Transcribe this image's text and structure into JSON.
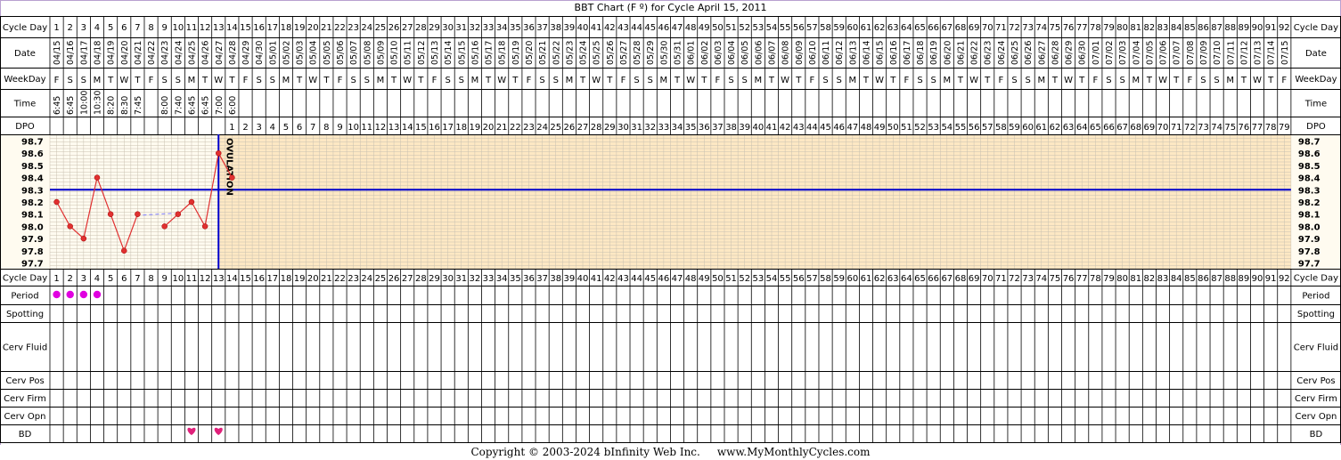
{
  "title": "BBT Chart (F º) for Cycle April 15, 2011",
  "copyright": "Copyright © 2003-2024 bInfinity Web Inc.     www.MyMonthlyCycles.com",
  "row_labels": [
    "Cycle Day",
    "Date",
    "WeekDay",
    "Time",
    "DPO",
    "Cycle Day",
    "Period",
    "Spotting",
    "Cerv Fluid",
    "Cerv Pos",
    "Cerv Firm",
    "Cerv Opn",
    "BD"
  ],
  "ovulation_label": "OVULATION",
  "colors": {
    "grid": "#000000",
    "panel_bg": "#fffbf0",
    "pre_ovulation_bg": "#fffbf0",
    "post_ovulation_bg": "#fde8c4",
    "cover_line": "#0000cc",
    "temp_line": "#e03030",
    "temp_dot": "#e03030",
    "period_dot": "#e000e0",
    "heart": "#e0207a",
    "dashed_line": "#8080ff",
    "border": "#b8a0d0"
  },
  "chart_data": {
    "type": "line",
    "title": "BBT Chart (F º) for Cycle April 15, 2011",
    "cycle_days": [
      1,
      2,
      3,
      4,
      5,
      6,
      7,
      8,
      9,
      10,
      11,
      12,
      13,
      14,
      15,
      16,
      17,
      18,
      19,
      20,
      21,
      22,
      23,
      24,
      25,
      26,
      27,
      28,
      29,
      30,
      31,
      32,
      33,
      34,
      35,
      36,
      37,
      38,
      39,
      40,
      41,
      42,
      43,
      44,
      45,
      46,
      47,
      48,
      49,
      50,
      51,
      52,
      53,
      54,
      55,
      56,
      57,
      58,
      59,
      60,
      61,
      62,
      63,
      64,
      65,
      66,
      67,
      68,
      69,
      70,
      71,
      72,
      73,
      74,
      75,
      76,
      77,
      78,
      79,
      80,
      81,
      82,
      83,
      84,
      85,
      86,
      87,
      88,
      89,
      90,
      91,
      92
    ],
    "dates": [
      "04/15",
      "04/16",
      "04/17",
      "04/18",
      "04/19",
      "04/20",
      "04/21",
      "04/22",
      "04/23",
      "04/24",
      "04/25",
      "04/26",
      "04/27",
      "04/28",
      "04/29",
      "04/30",
      "05/01",
      "05/02",
      "05/03",
      "05/04",
      "05/05",
      "05/06",
      "05/07",
      "05/08",
      "05/09",
      "05/10",
      "05/11",
      "05/12",
      "05/13",
      "05/14",
      "05/15",
      "05/16",
      "05/17",
      "05/18",
      "05/19",
      "05/20",
      "05/21",
      "05/22",
      "05/23",
      "05/24",
      "05/25",
      "05/26",
      "05/27",
      "05/28",
      "05/29",
      "05/30",
      "05/31",
      "06/01",
      "06/02",
      "06/03",
      "06/04",
      "06/05",
      "06/06",
      "06/07",
      "06/08",
      "06/09",
      "06/10",
      "06/11",
      "06/12",
      "06/13",
      "06/14",
      "06/15",
      "06/16",
      "06/17",
      "06/18",
      "06/19",
      "06/20",
      "06/21",
      "06/22",
      "06/23",
      "06/24",
      "06/25",
      "06/26",
      "06/27",
      "06/28",
      "06/29",
      "06/30",
      "07/01",
      "07/02",
      "07/03",
      "07/04",
      "07/05",
      "07/06",
      "07/07",
      "07/08",
      "07/09",
      "07/10",
      "07/11",
      "07/12",
      "07/13",
      "07/14",
      "07/15"
    ],
    "weekdays": [
      "F",
      "S",
      "S",
      "M",
      "T",
      "W",
      "T",
      "F",
      "S",
      "S",
      "M",
      "T",
      "W",
      "T",
      "F",
      "S",
      "S",
      "M",
      "T",
      "W",
      "T",
      "F",
      "S",
      "S",
      "M",
      "T",
      "W",
      "T",
      "F",
      "S",
      "S",
      "M",
      "T",
      "W",
      "T",
      "F",
      "S",
      "S",
      "M",
      "T",
      "W",
      "T",
      "F",
      "S",
      "S",
      "M",
      "T",
      "W",
      "T",
      "F",
      "S",
      "S",
      "M",
      "T",
      "W",
      "T",
      "F",
      "S",
      "S",
      "M",
      "T",
      "W",
      "T",
      "F",
      "S",
      "S",
      "M",
      "T",
      "W",
      "T",
      "F",
      "S",
      "S",
      "M",
      "T",
      "W",
      "T",
      "F",
      "S",
      "S",
      "M",
      "T",
      "W",
      "T",
      "F",
      "S",
      "S",
      "M",
      "T",
      "W",
      "T",
      "F"
    ],
    "times": [
      "6:45",
      "6:45",
      "10:00",
      "10:30",
      "8:20",
      "8:30",
      "7:45",
      "",
      "8:00",
      "7:40",
      "6:45",
      "6:45",
      "7:00",
      "6:00"
    ],
    "dpo_start_day": 14,
    "dpo_count": 79,
    "temperatures": [
      98.2,
      98.0,
      97.9,
      98.4,
      98.1,
      97.8,
      98.1,
      null,
      98.0,
      98.1,
      98.2,
      98.0,
      98.6,
      98.4
    ],
    "temperature_unit": "F",
    "y_ticks": [
      "98.7",
      "98.6",
      "98.5",
      "98.4",
      "98.3",
      "98.2",
      "98.1",
      "98.0",
      "97.9",
      "97.8",
      "97.7"
    ],
    "ylim": [
      97.7,
      98.7
    ],
    "cover_line": 98.3,
    "ovulation_day": 13,
    "dashed_segment_days": [
      8,
      9
    ],
    "period_days": [
      1,
      2,
      3,
      4
    ],
    "bd_days": [
      11,
      13
    ]
  }
}
